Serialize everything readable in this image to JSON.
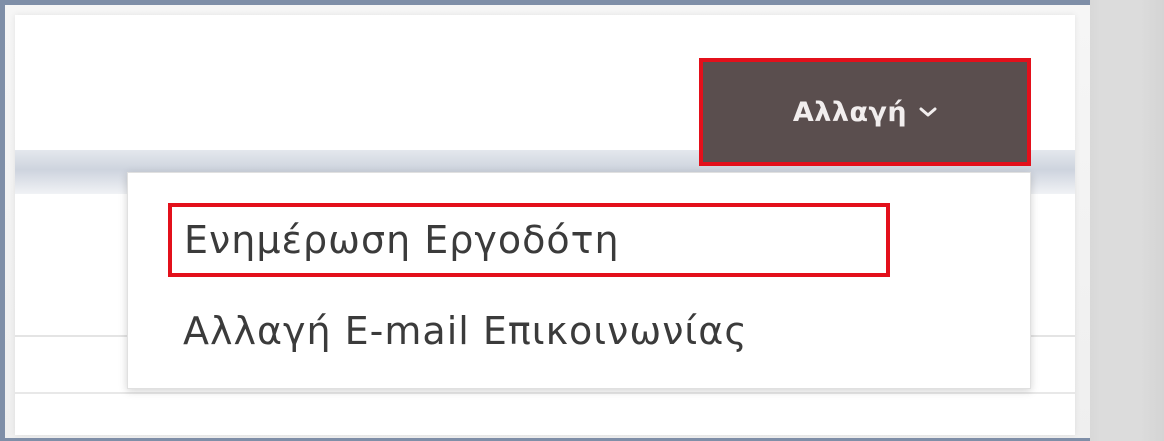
{
  "header": {
    "change_button_label": "Αλλαγή"
  },
  "icons": {
    "chevron": "chevron-down-icon"
  },
  "dropdown": {
    "items": [
      {
        "label": "Ενημέρωση Εργοδότη",
        "highlighted": true
      },
      {
        "label": "Αλλαγή E-mail Επικοινωνίας",
        "highlighted": false
      }
    ]
  },
  "colors": {
    "button_bg": "#5a4e4e",
    "highlight_border": "#e3101b",
    "frame_border": "#7f8fa8",
    "menu_text": "#3b3b3b"
  }
}
